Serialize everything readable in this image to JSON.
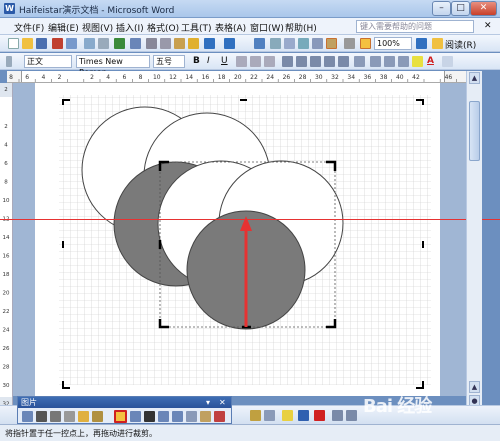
{
  "window": {
    "title": "Haifeistar演示文档 - Microsoft Word",
    "buttons": [
      "–",
      "□",
      "✕"
    ]
  },
  "menubar": {
    "items": [
      "文件(F)",
      "编辑(E)",
      "视图(V)",
      "插入(I)",
      "格式(O)",
      "工具(T)",
      "表格(A)",
      "窗口(W)",
      "帮助(H)"
    ],
    "help_placeholder": "键入需要帮助的问题",
    "help_close": "✕"
  },
  "standard_toolbar": {
    "zoom": "100%",
    "read_label": "阅读(R)"
  },
  "format_toolbar": {
    "style": "正文",
    "font": "Times New Roman",
    "size": "五号",
    "bold": "B",
    "italic": "I",
    "underline": "U",
    "font_color_glyph": "A"
  },
  "ruler_h": {
    "ticks": [
      "8",
      "6",
      "4",
      "2",
      "",
      "2",
      "4",
      "6",
      "8",
      "10",
      "12",
      "14",
      "16",
      "18",
      "20",
      "22",
      "24",
      "26",
      "28",
      "30",
      "32",
      "34",
      "36",
      "38",
      "40",
      "42",
      "",
      "46"
    ]
  },
  "ruler_v": {
    "ticks": [
      "2",
      "",
      "2",
      "4",
      "6",
      "8",
      "10",
      "12",
      "14",
      "16",
      "18",
      "20",
      "22",
      "24",
      "26",
      "28",
      "30",
      "32"
    ]
  },
  "picture_toolbar": {
    "title": "图片",
    "close": "✕",
    "dropdown": "▾"
  },
  "statusbar": {
    "message": "将指针置于任一控点上，再拖动进行裁剪。"
  },
  "watermark": "Bai 经验",
  "colors": {
    "circle_dark": "#7a7a7a",
    "circle_light": "#ffffff",
    "guide_line": "#e63232",
    "arrow": "#e63232",
    "grid": "#c8c8c8"
  }
}
